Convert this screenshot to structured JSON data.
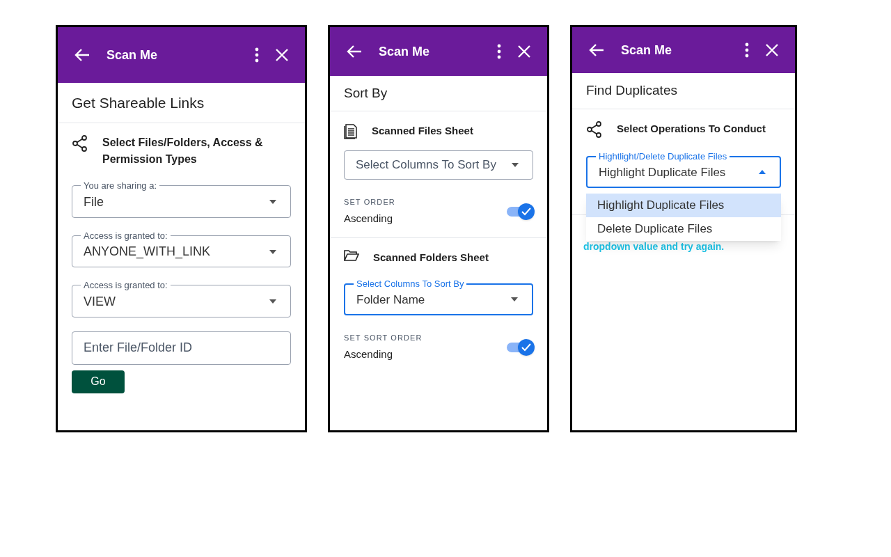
{
  "panels": [
    {
      "header": {
        "title": "Scan Me"
      },
      "page_title": "Get Shareable Links",
      "sections": [
        {
          "heading": "Select Files/Folders, Access & Permission Types",
          "controls": [
            {
              "kind": "select",
              "label": "You are sharing a:",
              "value": "File",
              "focused": false
            },
            {
              "kind": "select",
              "label": "Access is granted to:",
              "value": "ANYONE_WITH_LINK",
              "focused": false
            },
            {
              "kind": "select",
              "label": "Access is granted to:",
              "value": "VIEW",
              "focused": false
            },
            {
              "kind": "input",
              "placeholder": "Enter File/Folder ID"
            },
            {
              "kind": "button",
              "label": "Go"
            }
          ]
        }
      ]
    },
    {
      "header": {
        "title": "Scan Me"
      },
      "page_title": "Sort By",
      "sections": [
        {
          "heading": "Scanned Files Sheet",
          "controls": [
            {
              "kind": "select",
              "placeholder": "Select Columns To Sort By",
              "focused": false
            },
            {
              "kind": "toggle",
              "label": "SET ORDER",
              "value": "Ascending",
              "on": true
            }
          ]
        },
        {
          "heading": "Scanned Folders Sheet",
          "controls": [
            {
              "kind": "select",
              "label": "Select Columns To Sort By",
              "value": "Folder Name",
              "focused": true
            },
            {
              "kind": "toggle",
              "label": "SET SORT ORDER",
              "value": "Ascending",
              "on": true
            }
          ]
        }
      ]
    },
    {
      "header": {
        "title": "Scan Me"
      },
      "page_title": "Find Duplicates",
      "sections": [
        {
          "heading": "Select Operations To Conduct",
          "controls": [
            {
              "kind": "select",
              "label": "Hightlight/Delete Duplicate Files",
              "value": "Highlight Duplicate Files",
              "focused": true,
              "expanded": true,
              "options": [
                {
                  "label": "Highlight Duplicate Files",
                  "selected": true
                },
                {
                  "label": "Delete Duplicate Files",
                  "selected": false
                }
              ]
            }
          ]
        }
      ],
      "note": "dropdown value and try again."
    }
  ]
}
